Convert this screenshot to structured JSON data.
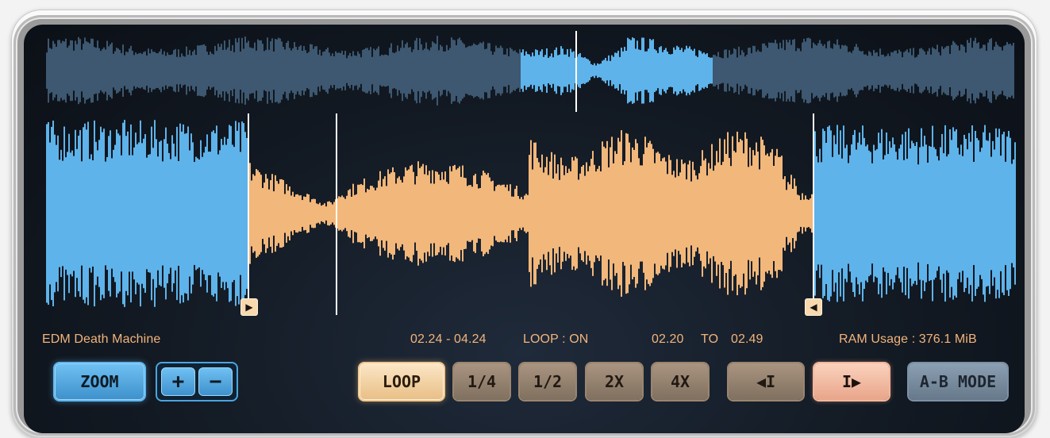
{
  "track": {
    "name": "EDM Death Machine",
    "range": "02.24 - 04.24",
    "loop_status": "LOOP : ON",
    "loop_from": "02.20",
    "loop_to_label": "TO",
    "loop_to": "02.49",
    "ram_usage": "RAM Usage : 376.1 MiB"
  },
  "buttons": {
    "zoom": "ZOOM",
    "zoom_in": "+",
    "zoom_out": "−",
    "loop": "LOOP",
    "quarter": "1/4",
    "half": "1/2",
    "double": "2X",
    "quad": "4X",
    "prev": "◀I",
    "next": "I▶",
    "ab_mode": "A-B MODE"
  },
  "markers": {
    "loop_start_icon": "play-right-icon",
    "loop_end_icon": "play-left-icon"
  },
  "colors": {
    "wave_blue": "#5eb3ea",
    "wave_dim": "#3d5870",
    "wave_loop": "#f2b77a",
    "label": "#f3b47c",
    "background": "#131a24"
  }
}
